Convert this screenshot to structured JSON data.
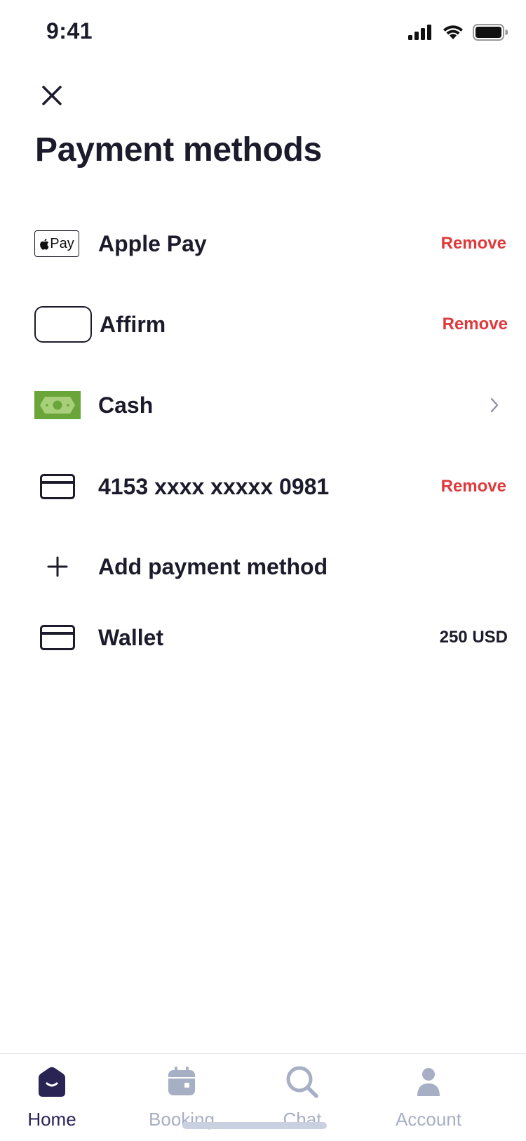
{
  "status_bar": {
    "time": "9:41"
  },
  "page": {
    "title": "Payment methods"
  },
  "methods": {
    "apple_pay": {
      "label": "Apple Pay",
      "badge": "Pay",
      "action": "Remove"
    },
    "affirm": {
      "label": "Affirm",
      "action": "Remove"
    },
    "cash": {
      "label": "Cash"
    },
    "card": {
      "label": "4153 xxxx xxxxx 0981",
      "action": "Remove"
    },
    "add": {
      "label": "Add payment method"
    },
    "wallet": {
      "label": "Wallet",
      "balance": "250 USD"
    }
  },
  "tabs": [
    {
      "label": "Home",
      "icon": "home-icon",
      "active": true
    },
    {
      "label": "Booking",
      "icon": "calendar-icon",
      "active": false
    },
    {
      "label": "Chat",
      "icon": "search-icon",
      "active": false
    },
    {
      "label": "Account",
      "icon": "user-icon",
      "active": false
    }
  ],
  "colors": {
    "text": "#1c1b2b",
    "remove": "#e0393b",
    "tab_inactive": "#a7afc4",
    "tab_active": "#2a2455",
    "cash_green": "#6aa53a"
  }
}
